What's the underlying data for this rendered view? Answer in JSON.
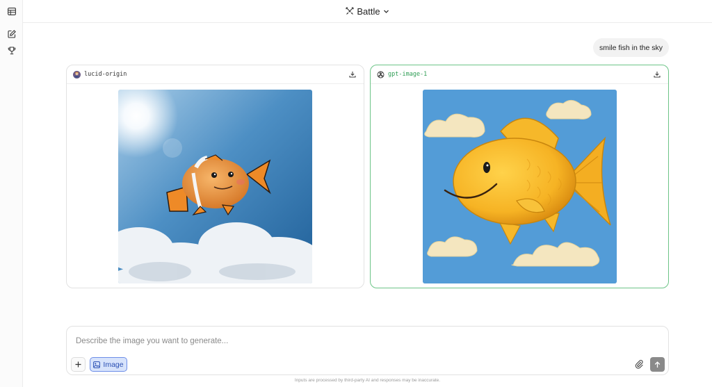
{
  "header": {
    "mode_label": "Battle"
  },
  "sidebar": {
    "items": [
      "table-icon",
      "new-chat-icon",
      "trophy-icon"
    ]
  },
  "prompt": {
    "text": "smile fish in the sky"
  },
  "cards": [
    {
      "model": "lucid-origin",
      "icon": "lucid-avatar-icon",
      "image": "cartoon clownfish flying in sunny sky photo"
    },
    {
      "model": "gpt-image-1",
      "icon": "openai-logo-icon",
      "image": "smiling goldfish painting with clouds"
    }
  ],
  "composer": {
    "placeholder": "Describe the image you want to generate...",
    "value": "",
    "image_label": "Image"
  },
  "footer": {
    "disclaimer": "Inputs are processed by third-party AI and responses may be inaccurate."
  },
  "colors": {
    "accent_green": "#6cc487",
    "image_btn_bg": "#d7e3fb",
    "send_btn": "#8a8a8a"
  }
}
